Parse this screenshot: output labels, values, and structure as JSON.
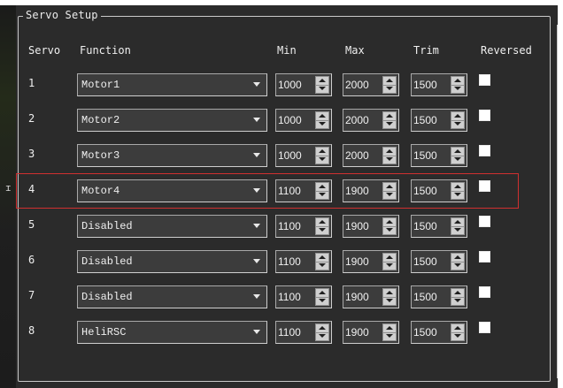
{
  "group_title": "Servo Setup",
  "headers": {
    "servo": "Servo",
    "function": "Function",
    "min": "Min",
    "max": "Max",
    "trim": "Trim",
    "reversed": "Reversed"
  },
  "rows": [
    {
      "servo": "1",
      "function": "Motor1",
      "min": "1000",
      "max": "2000",
      "trim": "1500",
      "reversed": false
    },
    {
      "servo": "2",
      "function": "Motor2",
      "min": "1000",
      "max": "2000",
      "trim": "1500",
      "reversed": false
    },
    {
      "servo": "3",
      "function": "Motor3",
      "min": "1000",
      "max": "2000",
      "trim": "1500",
      "reversed": false
    },
    {
      "servo": "4",
      "function": "Motor4",
      "min": "1100",
      "max": "1900",
      "trim": "1500",
      "reversed": false
    },
    {
      "servo": "5",
      "function": "Disabled",
      "min": "1100",
      "max": "1900",
      "trim": "1500",
      "reversed": false
    },
    {
      "servo": "6",
      "function": "Disabled",
      "min": "1100",
      "max": "1900",
      "trim": "1500",
      "reversed": false
    },
    {
      "servo": "7",
      "function": "Disabled",
      "min": "1100",
      "max": "1900",
      "trim": "1500",
      "reversed": false
    },
    {
      "servo": "8",
      "function": "HeliRSC",
      "min": "1100",
      "max": "1900",
      "trim": "1500",
      "reversed": false
    }
  ],
  "highlighted_row": "4",
  "colors": {
    "background": "#2b2b2b",
    "field": "#3c3c3c",
    "highlight_border": "#d03030"
  },
  "icons": {
    "combo": "chevron-down-icon",
    "spin": "spin-up-down-icon"
  }
}
